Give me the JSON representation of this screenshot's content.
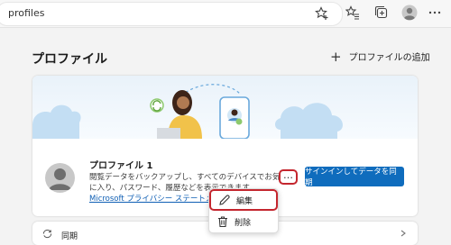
{
  "browser": {
    "address_text": "profiles"
  },
  "page": {
    "title": "プロファイル",
    "add_profile_label": "プロファイルの追加"
  },
  "profile": {
    "name": "プロファイル 1",
    "description": "閲覧データをバックアップし、すべてのデバイスでお気に入り、パスワード、履歴などを表示できます。",
    "privacy_link": "Microsoft プライバシー ステートメント",
    "sync_button": "サインインしてデータを同期",
    "more_button": "…"
  },
  "context_menu": {
    "edit_label": "編集",
    "delete_label": "削除"
  },
  "sections": {
    "sync_label": "同期"
  },
  "colors": {
    "accent": "#0f6cbd",
    "highlight": "#c4262e"
  }
}
